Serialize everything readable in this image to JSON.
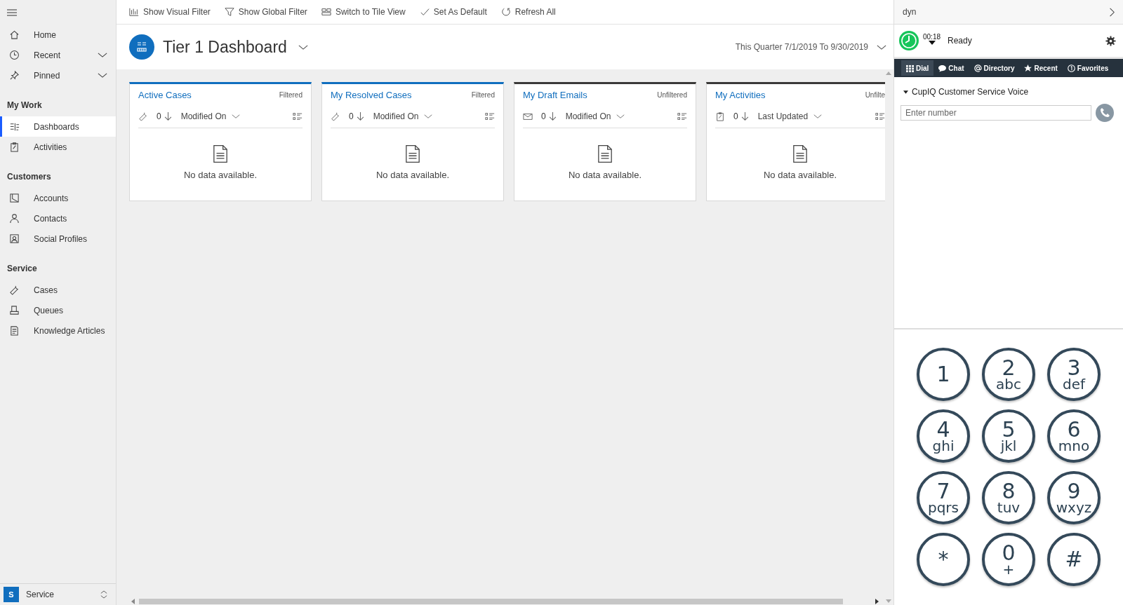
{
  "toolbar": [
    {
      "label": "Show Visual Filter"
    },
    {
      "label": "Show Global Filter"
    },
    {
      "label": "Switch to Tile View"
    },
    {
      "label": "Set As Default"
    },
    {
      "label": "Refresh All"
    }
  ],
  "sidebar": {
    "top": [
      {
        "label": "Home",
        "expandable": false
      },
      {
        "label": "Recent",
        "expandable": true
      },
      {
        "label": "Pinned",
        "expandable": true
      }
    ],
    "groups": [
      {
        "title": "My Work",
        "items": [
          {
            "label": "Dashboards",
            "selected": true
          },
          {
            "label": "Activities",
            "selected": false
          }
        ]
      },
      {
        "title": "Customers",
        "items": [
          {
            "label": "Accounts",
            "selected": false
          },
          {
            "label": "Contacts",
            "selected": false
          },
          {
            "label": "Social Profiles",
            "selected": false
          }
        ]
      },
      {
        "title": "Service",
        "items": [
          {
            "label": "Cases",
            "selected": false
          },
          {
            "label": "Queues",
            "selected": false
          },
          {
            "label": "Knowledge Articles",
            "selected": false
          }
        ]
      }
    ],
    "area": {
      "letter": "S",
      "label": "Service"
    }
  },
  "header": {
    "title": "Tier 1 Dashboard",
    "period": "This Quarter 7/1/2019 To 9/30/2019"
  },
  "cards": [
    {
      "title": "Active Cases",
      "filter": "Filtered",
      "count": "0",
      "sort": "Modified On",
      "kind": "case",
      "color": "#106ebe",
      "empty": "No data available."
    },
    {
      "title": "My Resolved Cases",
      "filter": "Filtered",
      "count": "0",
      "sort": "Modified On",
      "kind": "case",
      "color": "#106ebe",
      "empty": "No data available."
    },
    {
      "title": "My Draft Emails",
      "filter": "Unfiltered",
      "count": "0",
      "sort": "Modified On",
      "kind": "email",
      "color": "#3b3a39",
      "empty": "No data available."
    },
    {
      "title": "My Activities",
      "filter": "Unfilte",
      "count": "0",
      "sort": "Last Updated",
      "kind": "activity",
      "color": "#3b3a39",
      "empty": "No data available."
    }
  ],
  "phone": {
    "search": "dyn",
    "timer": "00:18",
    "status": "Ready",
    "tabs": [
      {
        "label": "Dial",
        "selected": true
      },
      {
        "label": "Chat",
        "selected": false
      },
      {
        "label": "Directory",
        "selected": false
      },
      {
        "label": "Recent",
        "selected": false
      },
      {
        "label": "Favorites",
        "selected": false
      }
    ],
    "provider": "CupIQ Customer Service Voice",
    "number": {
      "placeholder": "Enter number"
    },
    "keys": [
      {
        "digit": "1"
      },
      {
        "digit": "2",
        "letters": "abc"
      },
      {
        "digit": "3",
        "letters": "def"
      },
      {
        "digit": "4",
        "letters": "ghi"
      },
      {
        "digit": "5",
        "letters": "jkl"
      },
      {
        "digit": "6",
        "letters": "mno"
      },
      {
        "digit": "7",
        "letters": "pqrs"
      },
      {
        "digit": "8",
        "letters": "tuv"
      },
      {
        "digit": "9",
        "letters": "wxyz"
      },
      {
        "digit": "*"
      },
      {
        "digit": "0",
        "letters": "+"
      },
      {
        "digit": "#"
      }
    ]
  }
}
